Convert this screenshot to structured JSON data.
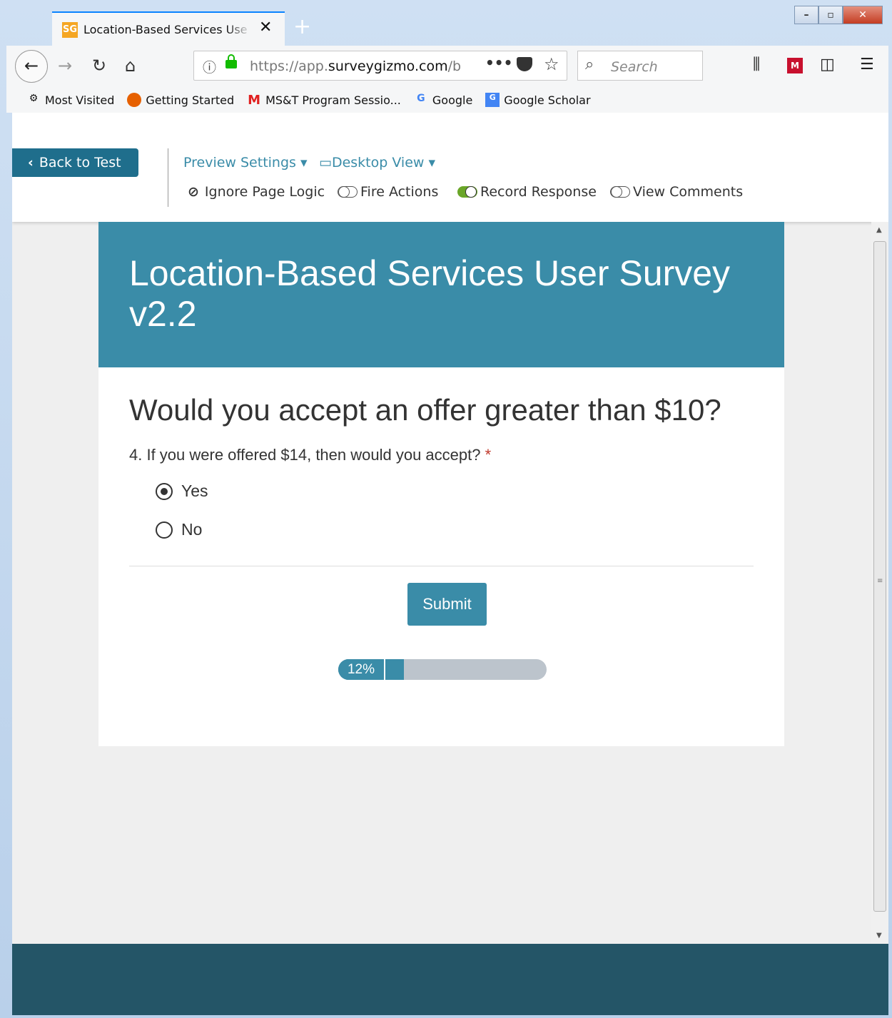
{
  "browser": {
    "tab_title": "Location-Based Services User Survey v2.2",
    "tab_favicon": "SG",
    "url_prefix": "https://app.",
    "url_domain": "surveygizmo.com",
    "url_suffix": "/b",
    "search_placeholder": "Search",
    "bookmarks": [
      {
        "label": "Most Visited",
        "icon": "gear-icon"
      },
      {
        "label": "Getting Started",
        "icon": "firefox-icon"
      },
      {
        "label": "MS&T Program Sessio...",
        "icon": "mst-logo-icon"
      },
      {
        "label": "Google",
        "icon": "google-icon"
      },
      {
        "label": "Google Scholar",
        "icon": "google-scholar-icon"
      }
    ]
  },
  "toolbar": {
    "back_label": "Back to Test",
    "preview_settings": "Preview Settings",
    "desktop_view": "Desktop View",
    "ignore_page_logic": "Ignore Page Logic",
    "fire_actions": "Fire Actions",
    "record_response": "Record Response",
    "view_comments": "View Comments",
    "record_response_on": true,
    "fire_actions_on": false,
    "view_comments_on": false
  },
  "survey": {
    "title": "Location-Based Services User Survey v2.2",
    "page_title": "Would you accept an offer greater than $10?",
    "question": "4. If you were offered $14, then would you accept?",
    "required_mark": "*",
    "options": [
      {
        "label": "Yes",
        "selected": true
      },
      {
        "label": "No",
        "selected": false
      }
    ],
    "submit_label": "Submit",
    "progress_label": "12%",
    "progress_value": 0.12
  },
  "colors": {
    "accent": "#3a8ca8",
    "back_button": "#1f6e8c",
    "footer": "#245567",
    "toggle_on": "#6aa628"
  }
}
